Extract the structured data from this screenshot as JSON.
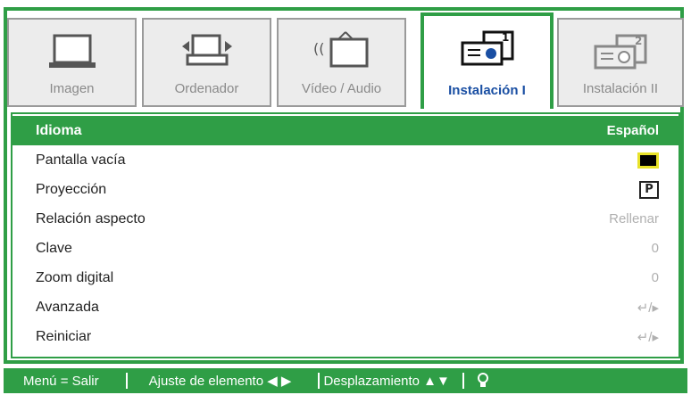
{
  "tabs": [
    {
      "label": "Imagen",
      "icon": "monitor-icon"
    },
    {
      "label": "Ordenador",
      "icon": "computer-icon"
    },
    {
      "label": "Vídeo / Audio",
      "icon": "video-audio-icon"
    },
    {
      "label": "Instalación I",
      "icon": "projector-icon",
      "active": true
    },
    {
      "label": "Instalación II",
      "icon": "projector-2-icon"
    }
  ],
  "menu": [
    {
      "label": "Idioma",
      "value": "Español",
      "selected": true
    },
    {
      "label": "Pantalla vacía",
      "value_icon": "blank-screen-swatch"
    },
    {
      "label": "Proyección",
      "value_icon": "projection-swatch",
      "value": "P"
    },
    {
      "label": "Relación aspecto",
      "value": "Rellenar"
    },
    {
      "label": "Clave",
      "value": "0"
    },
    {
      "label": "Zoom digital",
      "value": "0"
    },
    {
      "label": "Avanzada",
      "value": "↵/▸"
    },
    {
      "label": "Reiniciar",
      "value": "↵/▸"
    }
  ],
  "status": {
    "menu": "Menú = Salir",
    "adjust": "Ajuste de elemento ◀ ▶",
    "scroll": "Desplazamiento ▲▼",
    "help_icon": "lamp-icon"
  },
  "colors": {
    "accent": "#2f9e46",
    "active_tab_text": "#1a4fa3",
    "highlight": "#e8e22a"
  }
}
